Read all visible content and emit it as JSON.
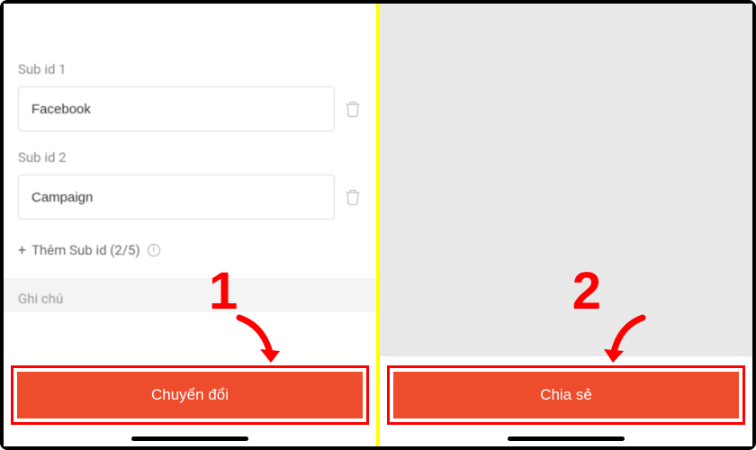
{
  "left": {
    "subId1Label": "Sub id 1",
    "subId1Value": "Facebook",
    "subId2Label": "Sub id 2",
    "subId2Value": "Campaign",
    "addSubIdText": "Thêm Sub id (2/5)",
    "noteLabel": "Ghi chú",
    "convertButton": "Chuyển đổi"
  },
  "right": {
    "shareButton": "Chia sẻ"
  },
  "annotations": {
    "step1": "1",
    "step2": "2"
  }
}
